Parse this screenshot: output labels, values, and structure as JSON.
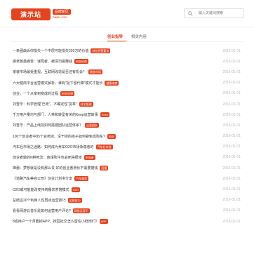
{
  "header": {
    "logo_text": "演示站",
    "logo_badge": "品牌新区",
    "logo_domain": "baidu.com",
    "search_placeholder": "输入关键词搜索"
  },
  "tabs": [
    {
      "label": "创业指导",
      "active": true
    },
    {
      "label": "相关内容",
      "active": false
    }
  ],
  "colors": {
    "accent": "#e4431e"
  },
  "articles": [
    {
      "title": "一条圈曲诉你损失一个中层可能损失200万的价值",
      "tag": "创业经营要诀",
      "date": "2016-01-01"
    },
    {
      "title": "做老板最痛苦：谋局者、被清司磁赚钱",
      "tag": "创业招商",
      "date": "2016-01-01"
    },
    {
      "title": "家装市场最受重视，互联网改造是否还有机会？",
      "tag": "装修市场",
      "date": "2016-01-01"
    },
    {
      "title": "六大健商平台运营模式解析，谁有“捉下留代降”模式才能长",
      "tag": "健康电商",
      "date": "2016-01-01"
    },
    {
      "title": "创业，一个从家到变成的过程",
      "tag": "创业设想",
      "date": "2016-01-01"
    },
    {
      "title": "刘雪华：科学管理“已死”，不确定性“变革”",
      "tag": "科学管理",
      "date": "2016-01-01"
    },
    {
      "title": "千万用户量均与部门，人林和转型有关的Keep运营故事",
      "tag": "Keep",
      "date": "2016-01-01"
    },
    {
      "title": "刘雪华：产品上线前如何搭建团队运营体系？",
      "tag": "运营团队",
      "date": "2016-01-01"
    },
    {
      "title": "100个创业者中95个会死掉，没干掉的孩子如何避免成狗东?",
      "tag": "创业",
      "date": "2016-01-01"
    },
    {
      "title": "汽车后市场之迷路：如何成为养车O2O市场争尊者的",
      "tag": "汽车后市场",
      "date": "2016-01-01"
    },
    {
      "title": "创业者做的N种死法：商靖吹牛也会死得很惨",
      "tag": "创业者",
      "date": "2016-01-01"
    },
    {
      "title": "田蕾：梦想就是没有那么贵 好的创业者增长不需要捷钱",
      "tag": "田蕾",
      "date": "2016-01-01"
    },
    {
      "title": "《道路汽车美容公司》创业计划书分享",
      "tag": "汽车美容",
      "date": "2016-01-01"
    },
    {
      "title": "O2O或可能能改变传统餐饮茶馆模式",
      "tag": "O2O",
      "date": "2016-01-01"
    },
    {
      "title": "总结这20个利用人性弱点运营技巧",
      "tag": "运营技巧",
      "date": "2016-01-01"
    },
    {
      "title": "看看网游云音乐是如何运营用户评论?",
      "tag": "网易云音乐",
      "date": "2016-01-01"
    },
    {
      "title": "8成用户一个月删掉APP，校园社交怎么留住小鲜肉们?",
      "tag": "APP",
      "date": "2016-01-01"
    }
  ]
}
